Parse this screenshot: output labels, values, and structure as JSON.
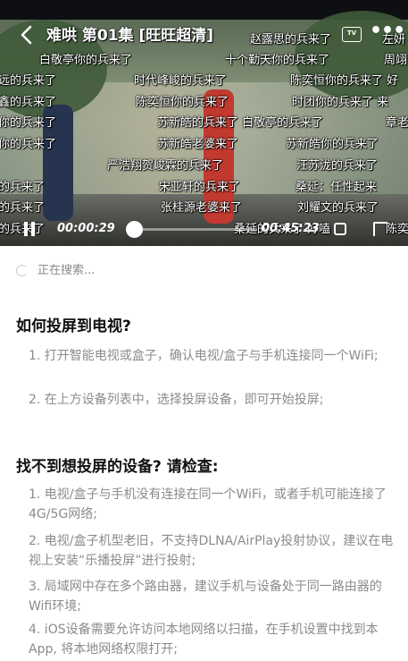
{
  "player": {
    "title": "难哄 第01集 [旺旺超清]",
    "back_icon": "chevron-left-icon",
    "cast_label": "TV",
    "more_label": "•••",
    "current_time": "00:00:29",
    "total_time": "00:45:23",
    "progress": 0.011,
    "danmaku": [
      "赵露思的兵来了",
      "左妍",
      "白敬亭你的兵来了",
      "十个勤天你的兵来了",
      "周翊",
      "远的兵来了",
      "时代峰峻的兵来了",
      "陈奕恒你的兵来了 好",
      "鑫的兵来了",
      "陈奕恒你的兵来了",
      "时团你的兵来了 来",
      "你的兵来了",
      "苏新皓的兵来了 白敬亭的兵来了",
      "章老",
      "你的兵来了",
      "苏新皓老婆来了",
      "苏新皓你的兵来了",
      "严浩翔贺峻霖的兵来了",
      "汪苏泷的兵来了",
      "的兵来了",
      "宋亚轩的兵来了",
      "桑延：任性起来",
      "的兵来了",
      "张桂源老婆来了",
      "刘耀文的兵来了",
      "的兵来了",
      "桑延的兵来了 好嗑",
      "陈奕"
    ]
  },
  "cast": {
    "searching_text": "正在搜索...",
    "how_title": "如何投屏到电视?",
    "how_steps": [
      "1. 打开智能电视或盒子，确认电视/盒子与手机连接同一个WiFi;",
      "2. 在上方设备列表中，选择投屏设备，即可开始投屏;"
    ],
    "trouble_title": "找不到想投屏的设备? 请检查:",
    "trouble_steps": [
      "1. 电视/盒子与手机没有连接在同一个WiFi，或者手机可能连接了4G/5G网络;",
      "2. 电视/盒子机型老旧，不支持DLNA/AirPlay投射协议，建议在电视上安装“乐播投屏”进行投射;",
      "3. 局域网中存在多个路由器，建议手机与设备处于同一路由器的Wifi环境;",
      "4. iOS设备需要允许访问本地网络以扫描，在手机设置中找到本App, 将本地网络权限打开;"
    ]
  }
}
